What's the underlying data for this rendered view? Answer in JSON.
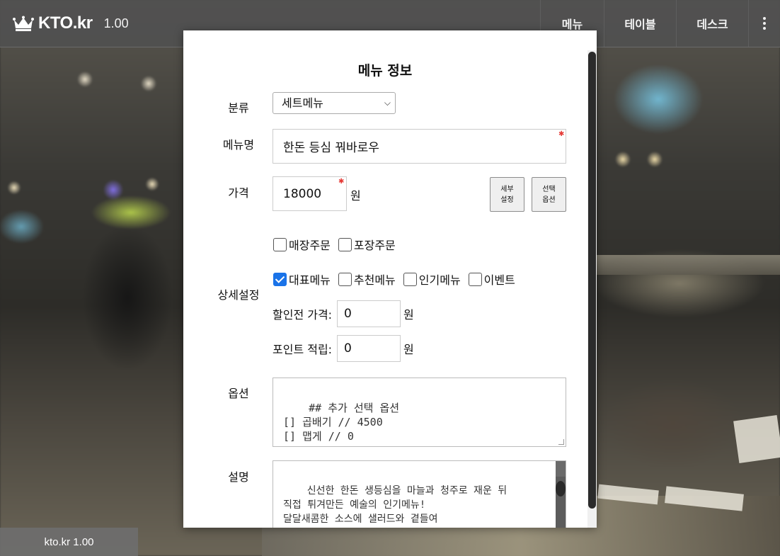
{
  "topbar": {
    "brand_name": "KTO.kr",
    "version": "1.00",
    "nav": [
      {
        "label": "메뉴"
      },
      {
        "label": "테이블"
      },
      {
        "label": "데스크"
      }
    ],
    "more_icon": "kebab-menu-icon"
  },
  "footer": {
    "version_label": "kto.kr 1.00"
  },
  "modal": {
    "title": "메뉴 정보",
    "category": {
      "label": "분류",
      "selected": "세트메뉴"
    },
    "menu_name": {
      "label": "메뉴명",
      "value": "한돈 등심 꿔바로우"
    },
    "price": {
      "label": "가격",
      "value": "18000",
      "unit": "원",
      "detail_button": [
        "세부",
        "설정"
      ],
      "option_button": [
        "선택",
        "옵션"
      ]
    },
    "details": {
      "label": "상세설정",
      "order_types": [
        {
          "label": "매장주문",
          "checked": false
        },
        {
          "label": "포장주문",
          "checked": false
        }
      ],
      "flags": [
        {
          "label": "대표메뉴",
          "checked": true
        },
        {
          "label": "추천메뉴",
          "checked": false
        },
        {
          "label": "인기메뉴",
          "checked": false
        },
        {
          "label": "이벤트",
          "checked": false
        }
      ],
      "original_price": {
        "label": "할인전 가격:",
        "value": "0",
        "unit": "원"
      },
      "points": {
        "label": "포인트 적립:",
        "value": "0",
        "unit": "원"
      }
    },
    "options": {
      "label": "옵션",
      "text": "## 추가 선택 옵션\n[] 곱배기 // 4500\n[] 맵게 // 0"
    },
    "description": {
      "label": "설명",
      "text": "신선한 한돈 생등심을 마늘과 청주로 재운 뒤\n직접 튀겨만든 예술의 인기메뉴!\n달달새콤한 소스에 샐러드와 곁들여\n입맛을 더욱 돋아주는 겉바속촉의 대명사!"
    }
  },
  "colors": {
    "topbar_bg": "#505050",
    "checkbox_checked": "#1a73e8",
    "required_mark": "#e53935"
  }
}
